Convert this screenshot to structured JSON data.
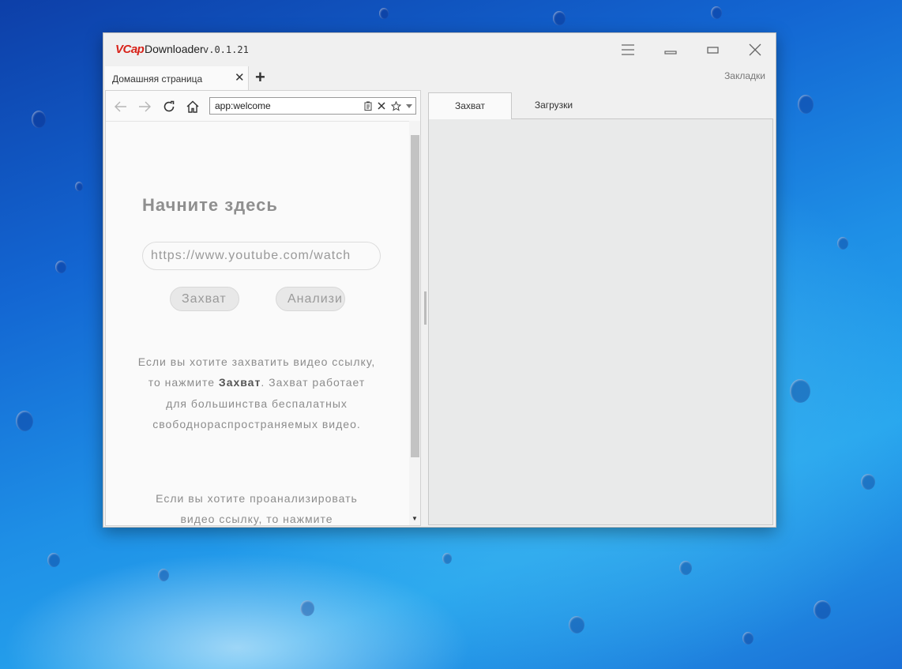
{
  "app": {
    "logo_brand": "VCap",
    "logo_rest": "Downloader",
    "version": "v.0.1.21",
    "icons": [
      "hamburger-menu-icon",
      "minimize-icon",
      "maximize-icon",
      "close-icon"
    ]
  },
  "tabs": {
    "active_tab_label": "Домашняя страница",
    "close_glyph": "✕",
    "new_tab_glyph": "+",
    "bookmarks_label": "Закладки"
  },
  "navbar": {
    "url": "app:welcome",
    "icons": [
      "back-arrow-icon",
      "forward-arrow-icon",
      "reload-icon",
      "home-icon",
      "clipboard-icon",
      "clear-icon",
      "star-icon",
      "dropdown-icon"
    ]
  },
  "welcome": {
    "title": "Начните здесь",
    "input_placeholder": "https://www.youtube.com/watch",
    "capture_button": "Захват",
    "analyze_button": "Анализи",
    "help1_before": "Если вы хотите захватить видео ссылку, то нажмите ",
    "help1_bold": "Захват",
    "help1_after": ". Захват работает для большинства беспалатных свободнораспространяемых видео.",
    "help2": "Если вы хотите проанализировать видео ссылку, то нажмите"
  },
  "right_panel": {
    "tabs": [
      {
        "label": "Захват",
        "active": true
      },
      {
        "label": "Загрузки",
        "active": false
      }
    ]
  },
  "colors": {
    "brand_red": "#d8231a",
    "window_bg": "#f0f0f0",
    "page_bg": "#fafafa",
    "muted_text": "#8c8c8c"
  }
}
